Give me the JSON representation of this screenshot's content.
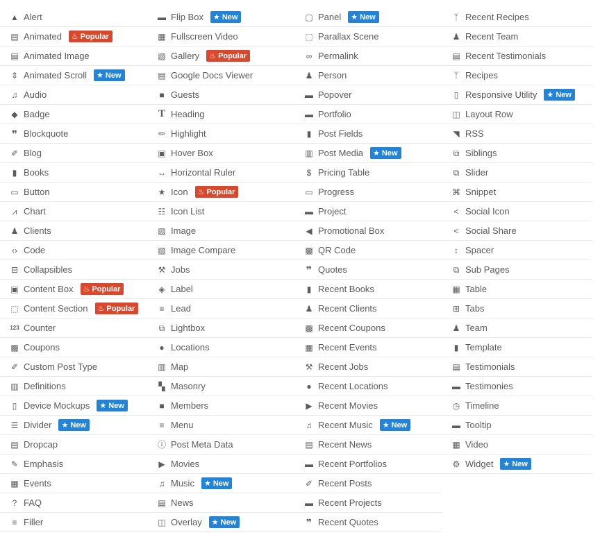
{
  "colors": {
    "new_badge": "#2383d6",
    "popular_badge": "#d9482d",
    "text": "#5a5a5a",
    "divider": "#e8e8e8"
  },
  "badges": {
    "new": "New",
    "popular": "Popular"
  },
  "columns": [
    [
      {
        "label": "Alert",
        "icon": "warning-icon"
      },
      {
        "label": "Animated",
        "icon": "clapperboard-icon",
        "badge": "popular"
      },
      {
        "label": "Animated Image",
        "icon": "clapperboard-icon"
      },
      {
        "label": "Animated Scroll",
        "icon": "sort-icon",
        "badge": "new"
      },
      {
        "label": "Audio",
        "icon": "music-icon"
      },
      {
        "label": "Badge",
        "icon": "tag-icon"
      },
      {
        "label": "Blockquote",
        "icon": "quote-icon"
      },
      {
        "label": "Blog",
        "icon": "pushpin-icon"
      },
      {
        "label": "Books",
        "icon": "book-icon"
      },
      {
        "label": "Button",
        "icon": "button-icon"
      },
      {
        "label": "Chart",
        "icon": "line-chart-icon"
      },
      {
        "label": "Clients",
        "icon": "user-tie-icon"
      },
      {
        "label": "Code",
        "icon": "code-icon"
      },
      {
        "label": "Collapsibles",
        "icon": "minus-square-icon"
      },
      {
        "label": "Content Box",
        "icon": "archive-icon",
        "badge": "popular"
      },
      {
        "label": "Content Section",
        "icon": "dashed-square-icon",
        "badge": "popular"
      },
      {
        "label": "Counter",
        "icon": "numbers-icon"
      },
      {
        "label": "Coupons",
        "icon": "coupon-icon"
      },
      {
        "label": "Custom Post Type",
        "icon": "pushpin-icon"
      },
      {
        "label": "Definitions",
        "icon": "open-book-icon"
      },
      {
        "label": "Device Mockups",
        "icon": "tablet-icon",
        "badge": "new"
      },
      {
        "label": "Divider",
        "icon": "divider-icon",
        "badge": "new"
      },
      {
        "label": "Dropcap",
        "icon": "dropcap-icon"
      },
      {
        "label": "Emphasis",
        "icon": "pencil-icon"
      },
      {
        "label": "Events",
        "icon": "calendar-icon"
      },
      {
        "label": "FAQ",
        "icon": "question-circle-icon"
      },
      {
        "label": "Filler",
        "icon": "lines-icon"
      }
    ],
    [
      {
        "label": "Flip Box",
        "icon": "inbox-icon",
        "badge": "new"
      },
      {
        "label": "Fullscreen Video",
        "icon": "film-icon"
      },
      {
        "label": "Gallery",
        "icon": "images-icon",
        "badge": "popular"
      },
      {
        "label": "Google Docs Viewer",
        "icon": "document-icon"
      },
      {
        "label": "Guests",
        "icon": "unlock-icon"
      },
      {
        "label": "Heading",
        "icon": "heading-icon"
      },
      {
        "label": "Highlight",
        "icon": "highlighter-icon"
      },
      {
        "label": "Hover Box",
        "icon": "archive-icon"
      },
      {
        "label": "Horizontal Ruler",
        "icon": "arrows-horizontal-icon"
      },
      {
        "label": "Icon",
        "icon": "star-square-icon",
        "badge": "popular"
      },
      {
        "label": "Icon List",
        "icon": "list-icon"
      },
      {
        "label": "Image",
        "icon": "image-icon"
      },
      {
        "label": "Image Compare",
        "icon": "images-icon"
      },
      {
        "label": "Jobs",
        "icon": "hammer-icon"
      },
      {
        "label": "Label",
        "icon": "label-tag-icon"
      },
      {
        "label": "Lead",
        "icon": "lines-icon"
      },
      {
        "label": "Lightbox",
        "icon": "external-box-icon"
      },
      {
        "label": "Locations",
        "icon": "map-marker-icon"
      },
      {
        "label": "Map",
        "icon": "map-icon"
      },
      {
        "label": "Masonry",
        "icon": "masonry-icon"
      },
      {
        "label": "Members",
        "icon": "lock-icon"
      },
      {
        "label": "Menu",
        "icon": "menu-icon"
      },
      {
        "label": "Post Meta Data",
        "icon": "info-circle-icon"
      },
      {
        "label": "Movies",
        "icon": "play-icon"
      },
      {
        "label": "Music",
        "icon": "music-icon",
        "badge": "new"
      },
      {
        "label": "News",
        "icon": "newspaper-icon"
      },
      {
        "label": "Overlay",
        "icon": "overlay-icon",
        "badge": "new"
      }
    ],
    [
      {
        "label": "Panel",
        "icon": "window-icon",
        "badge": "new"
      },
      {
        "label": "Parallax Scene",
        "icon": "dashed-square-icon"
      },
      {
        "label": "Permalink",
        "icon": "link-icon"
      },
      {
        "label": "Person",
        "icon": "user-icon"
      },
      {
        "label": "Popover",
        "icon": "comment-icon"
      },
      {
        "label": "Portfolio",
        "icon": "briefcase-icon"
      },
      {
        "label": "Post Fields",
        "icon": "clipboard-icon"
      },
      {
        "label": "Post Media",
        "icon": "media-icon",
        "badge": "new"
      },
      {
        "label": "Pricing Table",
        "icon": "dollar-icon"
      },
      {
        "label": "Progress",
        "icon": "progress-icon"
      },
      {
        "label": "Project",
        "icon": "briefcase-icon"
      },
      {
        "label": "Promotional Box",
        "icon": "bullhorn-icon"
      },
      {
        "label": "QR Code",
        "icon": "qrcode-icon"
      },
      {
        "label": "Quotes",
        "icon": "quote-icon"
      },
      {
        "label": "Recent Books",
        "icon": "book-icon"
      },
      {
        "label": "Recent Clients",
        "icon": "user-tie-icon"
      },
      {
        "label": "Recent Coupons",
        "icon": "coupon-icon"
      },
      {
        "label": "Recent Events",
        "icon": "calendar-icon"
      },
      {
        "label": "Recent Jobs",
        "icon": "hammer-icon"
      },
      {
        "label": "Recent Locations",
        "icon": "map-marker-icon"
      },
      {
        "label": "Recent Movies",
        "icon": "play-icon"
      },
      {
        "label": "Recent Music",
        "icon": "music-icon",
        "badge": "new"
      },
      {
        "label": "Recent News",
        "icon": "newspaper-icon"
      },
      {
        "label": "Recent Portfolios",
        "icon": "briefcase-icon"
      },
      {
        "label": "Recent Posts",
        "icon": "pushpin-icon"
      },
      {
        "label": "Recent Projects",
        "icon": "briefcase-icon"
      },
      {
        "label": "Recent Quotes",
        "icon": "quote-icon"
      }
    ],
    [
      {
        "label": "Recent Recipes",
        "icon": "cutlery-icon"
      },
      {
        "label": "Recent Team",
        "icon": "users-icon"
      },
      {
        "label": "Recent Testimonials",
        "icon": "comment-text-icon"
      },
      {
        "label": "Recipes",
        "icon": "cutlery-icon"
      },
      {
        "label": "Responsive Utility",
        "icon": "devices-icon",
        "badge": "new"
      },
      {
        "label": "Layout Row",
        "icon": "columns-icon"
      },
      {
        "label": "RSS",
        "icon": "rss-icon"
      },
      {
        "label": "Siblings",
        "icon": "copy-icon"
      },
      {
        "label": "Slider",
        "icon": "slides-icon"
      },
      {
        "label": "Snippet",
        "icon": "command-icon"
      },
      {
        "label": "Social Icon",
        "icon": "share-icon"
      },
      {
        "label": "Social Share",
        "icon": "share-icon"
      },
      {
        "label": "Spacer",
        "icon": "arrows-vertical-icon"
      },
      {
        "label": "Sub Pages",
        "icon": "copy-icon"
      },
      {
        "label": "Table",
        "icon": "table-icon"
      },
      {
        "label": "Tabs",
        "icon": "folder-plus-icon"
      },
      {
        "label": "Team",
        "icon": "users-icon"
      },
      {
        "label": "Template",
        "icon": "clipboard-icon"
      },
      {
        "label": "Testimonials",
        "icon": "comment-text-icon"
      },
      {
        "label": "Testimonies",
        "icon": "comment-dots-icon"
      },
      {
        "label": "Timeline",
        "icon": "clock-icon"
      },
      {
        "label": "Tooltip",
        "icon": "comment-icon"
      },
      {
        "label": "Video",
        "icon": "film-icon"
      },
      {
        "label": "Widget",
        "icon": "cog-icon",
        "badge": "new"
      }
    ]
  ]
}
